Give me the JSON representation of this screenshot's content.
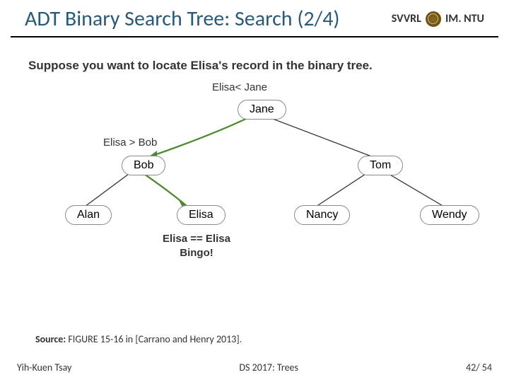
{
  "header": {
    "title": "ADT Binary Search Tree: Search (2/4)",
    "lab": "SVVRL",
    "org": "IM. NTU"
  },
  "body_text": "Suppose you want to locate Elisa's record in the binary tree.",
  "annotations": {
    "cmp1": "Elisa< Jane",
    "cmp2": "Elisa > Bob",
    "found_line1": "Elisa == Elisa",
    "found_line2": "Bingo!"
  },
  "nodes": {
    "root": "Jane",
    "l": "Bob",
    "r": "Tom",
    "ll": "Alan",
    "lr": "Elisa",
    "rl": "Nancy",
    "rr": "Wendy"
  },
  "source": {
    "label": "Source:",
    "text": " FIGURE 15-16 in [Carrano and Henry 2013]."
  },
  "footer": {
    "author": "Yih-Kuen Tsay",
    "course": "DS 2017: Trees",
    "page": "42",
    "total": "54",
    "sep": "/ "
  }
}
